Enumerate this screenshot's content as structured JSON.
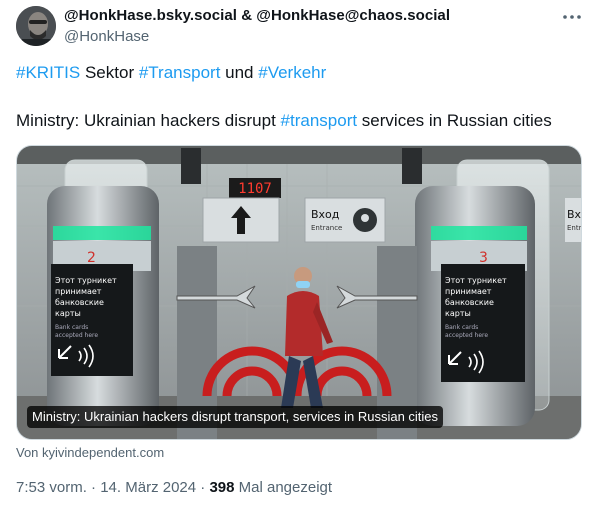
{
  "author": {
    "display_name": "@HonkHase.bsky.social & @HonkHase@chaos.social",
    "handle": "@HonkHase"
  },
  "menu": {
    "more_icon": "ellipsis-horizontal-icon"
  },
  "tweet": {
    "line1": {
      "hashtag1": "#KRITIS",
      "text1": " Sektor ",
      "hashtag2": "#Transport",
      "text2": " und ",
      "hashtag3": "#Verkehr"
    },
    "line2": {
      "text1": "Ministry: Ukrainian hackers disrupt ",
      "hashtag": "#transport",
      "text2": " services in Russian cities"
    }
  },
  "card": {
    "caption": "Ministry: Ukrainian hackers disrupt transport, services in Russian cities",
    "source": "Von kyivindependent.com",
    "image": {
      "counter": "1107",
      "entrance_ru": "Вход",
      "entrance_en": "Entrance",
      "entrance_ru_right": "Вх",
      "entrance_en_right": "Entr",
      "gate_left_number": "2",
      "gate_right_number": "3",
      "turnstile_text_ru_1": "Этот турникет",
      "turnstile_text_ru_2": "принимает",
      "turnstile_text_ru_3": "банковские",
      "turnstile_text_ru_4": "карты",
      "turnstile_text_en_1": "Bank cards",
      "turnstile_text_en_2": "accepted here"
    }
  },
  "meta": {
    "time": "7:53 vorm.",
    "separator1": " · ",
    "date": "14. März 2024",
    "separator2": " · ",
    "views_count": "398",
    "views_label": " Mal angezeigt"
  },
  "colors": {
    "link": "#1d9bf0",
    "secondary_text": "#536471",
    "primary_text": "#0f1419"
  }
}
